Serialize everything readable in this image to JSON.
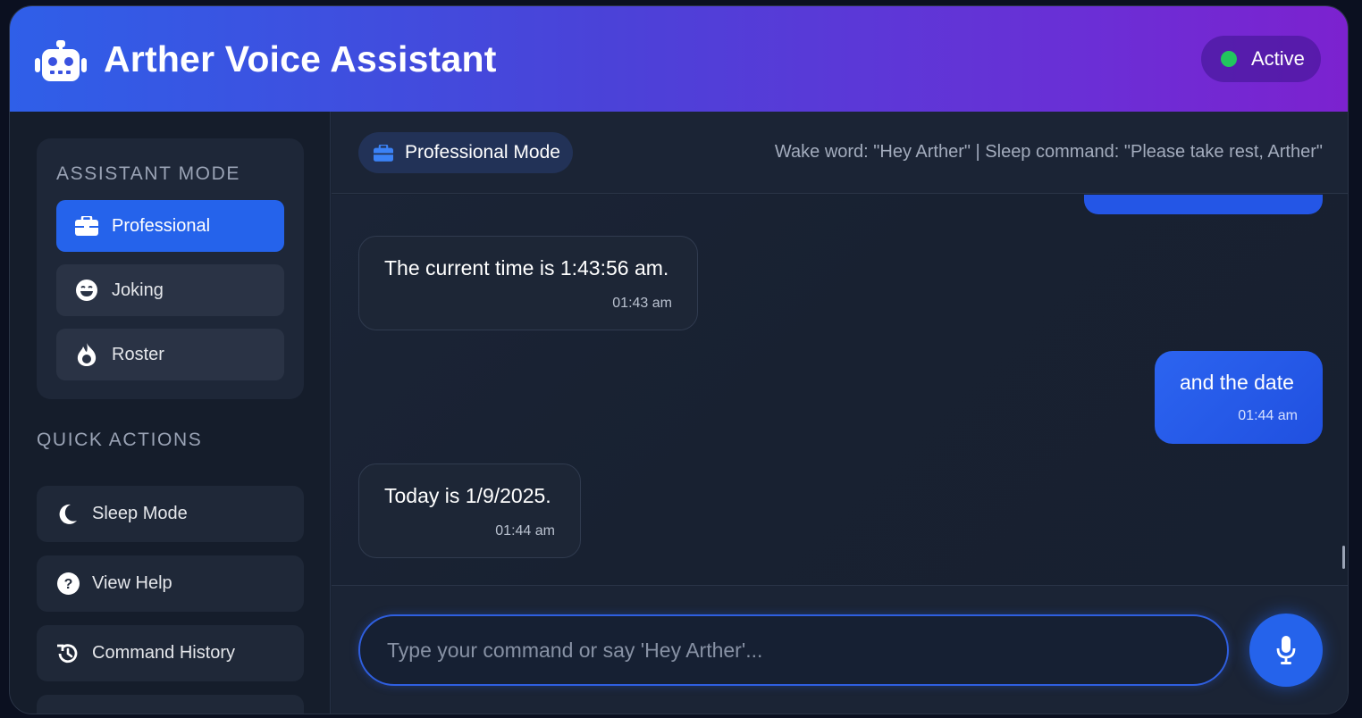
{
  "app": {
    "title": "Arther Voice Assistant",
    "status": "Active",
    "logo_icon": "robot-icon"
  },
  "sidebar": {
    "mode_section_title": "ASSISTANT MODE",
    "modes": [
      {
        "label": "Professional",
        "icon": "briefcase-icon",
        "active": true
      },
      {
        "label": "Joking",
        "icon": "laugh-icon",
        "active": false
      },
      {
        "label": "Roster",
        "icon": "fire-icon",
        "active": false
      }
    ],
    "quick_section_title": "QUICK ACTIONS",
    "quick_actions": [
      {
        "label": "Sleep Mode",
        "icon": "moon-icon"
      },
      {
        "label": "View Help",
        "icon": "question-circle-icon"
      },
      {
        "label": "Command History",
        "icon": "history-icon"
      },
      {
        "label": "",
        "icon": "gear-icon"
      }
    ]
  },
  "topbar": {
    "mode_badge": "Professional Mode",
    "hint": "Wake word: \"Hey Arther\" | Sleep command: \"Please take rest, Arther\""
  },
  "messages": [
    {
      "role": "assistant",
      "text": "The current time is 1:43:56 am.",
      "time": "01:43 am"
    },
    {
      "role": "user",
      "text": "and the date",
      "time": "01:44 am"
    },
    {
      "role": "assistant",
      "text": "Today is 1/9/2025.",
      "time": "01:44 am"
    }
  ],
  "input": {
    "placeholder": "Type your command or say 'Hey Arther'...",
    "value": ""
  },
  "colors": {
    "accent": "#2563eb",
    "status_active": "#22c55e",
    "header_gradient_start": "#2f5fe8",
    "header_gradient_end": "#7c22cf"
  }
}
